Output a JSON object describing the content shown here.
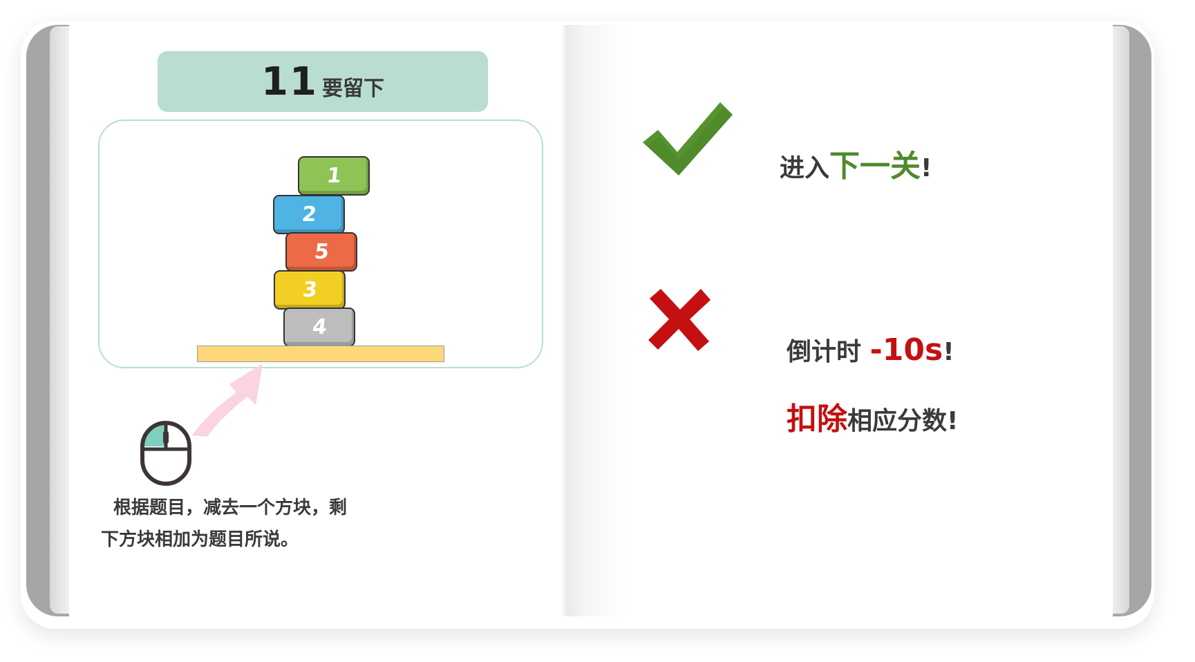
{
  "title": {
    "number": "11",
    "text": "要留下"
  },
  "blocks": [
    {
      "label": "1",
      "color": "#8fc356"
    },
    {
      "label": "2",
      "color": "#4fb3e3"
    },
    {
      "label": "5",
      "color": "#ec6a45"
    },
    {
      "label": "3",
      "color": "#f2cf25"
    },
    {
      "label": "4",
      "color": "#bdbdbd"
    }
  ],
  "instruction": "根据题目，减去一个方块，剩下方块相加为题目所说。",
  "correct": {
    "prefix": "进入",
    "highlight": "下一关",
    "suffix": "!"
  },
  "wrong": {
    "line1_prefix": "倒计时 ",
    "line1_highlight": "-10s",
    "line1_suffix": "!",
    "line2_highlight": "扣除",
    "line2_suffix": "相应分数!"
  },
  "colors": {
    "title_bg": "#b9ddd1",
    "success": "#4f8a2b",
    "fail": "#c41010",
    "platform": "#fdd87a",
    "arrow": "#fcd3e3",
    "mouse_accent": "#7ecfbf"
  },
  "icons": {
    "success": "check-mark-icon",
    "fail": "cross-mark-icon",
    "mouse": "mouse-icon",
    "arrow": "curved-arrow-icon"
  }
}
